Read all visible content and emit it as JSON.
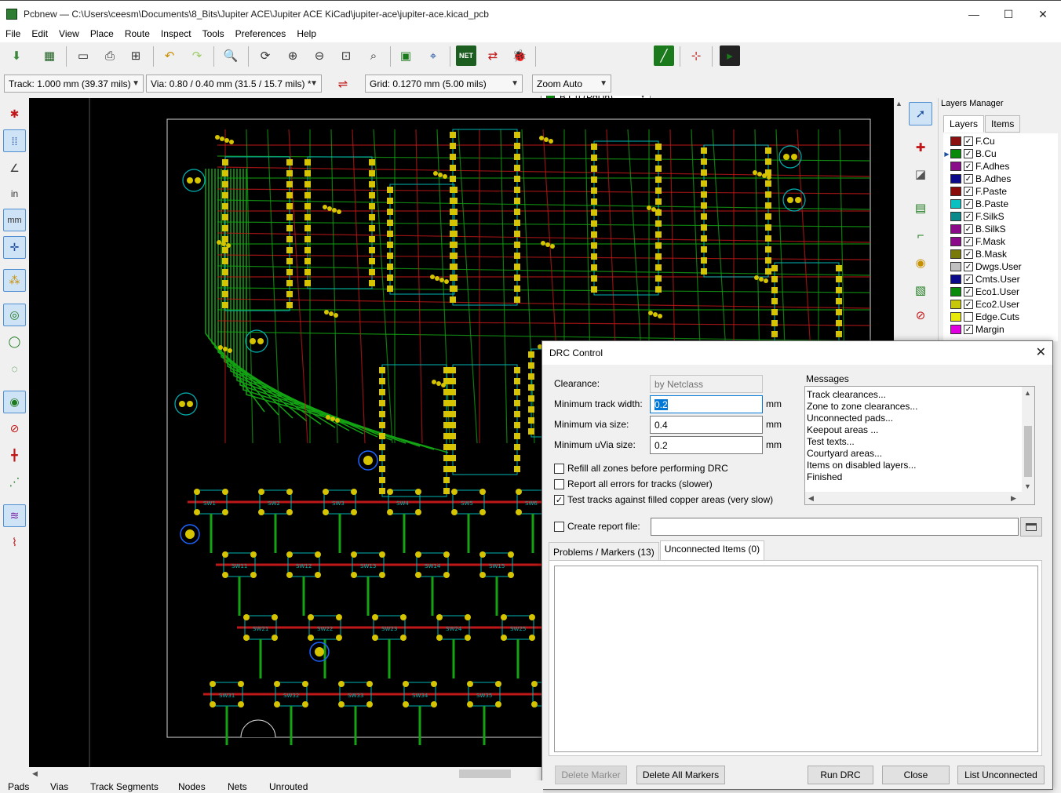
{
  "window": {
    "title": "Pcbnew — C:\\Users\\ceesm\\Documents\\8_Bits\\Jupiter ACE\\Jupiter ACE KiCad\\jupiter-ace\\jupiter-ace.kicad_pcb",
    "minimize": "—",
    "maximize": "☐",
    "close": "✕"
  },
  "menu": [
    "File",
    "Edit",
    "View",
    "Place",
    "Route",
    "Inspect",
    "Tools",
    "Preferences",
    "Help"
  ],
  "toolbar": {
    "active_layer": "B.Cu (PgDn)",
    "active_layer_color": "#0a8a0a",
    "track_width": "Track: 1.000 mm (39.37 mils)",
    "via_size": "Via: 0.80 / 0.40 mm (31.5 / 15.7 mils) *",
    "grid": "Grid: 0.1270 mm (5.00 mils)",
    "zoom": "Zoom Auto"
  },
  "layers_manager": {
    "title": "Layers Manager",
    "tabs": [
      "Layers",
      "Items"
    ],
    "layers": [
      {
        "name": "F.Cu",
        "color": "#8b1010",
        "checked": "✓",
        "marker": ""
      },
      {
        "name": "B.Cu",
        "color": "#0a8a0a",
        "checked": "✓",
        "marker": "▶"
      },
      {
        "name": "F.Adhes",
        "color": "#8a0d8a",
        "checked": "✓",
        "marker": ""
      },
      {
        "name": "B.Adhes",
        "color": "#0a0a8a",
        "checked": "✓",
        "marker": ""
      },
      {
        "name": "F.Paste",
        "color": "#8a0a0a",
        "checked": "✓",
        "marker": ""
      },
      {
        "name": "B.Paste",
        "color": "#0ac0c0",
        "checked": "✓",
        "marker": ""
      },
      {
        "name": "F.SilkS",
        "color": "#0a8a8a",
        "checked": "✓",
        "marker": ""
      },
      {
        "name": "B.SilkS",
        "color": "#8a0a8a",
        "checked": "✓",
        "marker": ""
      },
      {
        "name": "F.Mask",
        "color": "#8a0a8a",
        "checked": "✓",
        "marker": ""
      },
      {
        "name": "B.Mask",
        "color": "#7a7a0a",
        "checked": "✓",
        "marker": ""
      },
      {
        "name": "Dwgs.User",
        "color": "#c0c0c0",
        "checked": "✓",
        "marker": ""
      },
      {
        "name": "Cmts.User",
        "color": "#0a0a8a",
        "checked": "✓",
        "marker": ""
      },
      {
        "name": "Eco1.User",
        "color": "#0a8a0a",
        "checked": "✓",
        "marker": ""
      },
      {
        "name": "Eco2.User",
        "color": "#c8c80a",
        "checked": "✓",
        "marker": ""
      },
      {
        "name": "Edge.Cuts",
        "color": "#e8e80a",
        "checked": "",
        "marker": ""
      },
      {
        "name": "Margin",
        "color": "#e000e0",
        "checked": "✓",
        "marker": ""
      }
    ]
  },
  "drc": {
    "title": "DRC Control",
    "close_icon": "✕",
    "clearance_label": "Clearance:",
    "clearance_value": "by Netclass",
    "min_track_label": "Minimum track width:",
    "min_track_value": "0.2",
    "min_via_label": "Minimum via size:",
    "min_via_value": "0.4",
    "min_uvia_label": "Minimum uVia size:",
    "min_uvia_value": "0.2",
    "unit": "mm",
    "options": [
      {
        "label": "Refill all zones before performing DRC",
        "checked": ""
      },
      {
        "label": "Report all errors for tracks (slower)",
        "checked": ""
      },
      {
        "label": "Test tracks against filled copper areas (very slow)",
        "checked": "✓"
      }
    ],
    "report_label": "Create report file:",
    "report_checked": "",
    "report_path": "",
    "messages_label": "Messages",
    "messages": [
      "Track clearances...",
      "Zone to zone clearances...",
      "Unconnected pads...",
      "Keepout areas ...",
      "Test texts...",
      "Courtyard areas...",
      "Items on disabled layers...",
      "Finished"
    ],
    "tabs": [
      "Problems / Markers (13)",
      "Unconnected Items (0)"
    ],
    "buttons": {
      "delete_marker": "Delete Marker",
      "delete_all": "Delete All Markers",
      "run": "Run DRC",
      "close": "Close",
      "list_unconnected": "List Unconnected"
    }
  },
  "status_bar": [
    "Pads",
    "Vias",
    "Track Segments",
    "Nodes",
    "Nets",
    "Unrouted"
  ],
  "pcb": {
    "labels": [
      "SW1",
      "SW2",
      "SW3",
      "SW4",
      "SW5",
      "SW6",
      "SW11",
      "SW12",
      "SW13",
      "SW14",
      "SW15",
      "SW21",
      "SW22",
      "SW23",
      "SW24",
      "SW25",
      "SW31",
      "SW32",
      "SW33",
      "SW34",
      "SW35"
    ],
    "colors": {
      "top": "#c01818",
      "bottom": "#13a313",
      "pad": "#d6c400",
      "silk": "#00b4b4",
      "edge": "#d8d8d8"
    }
  }
}
